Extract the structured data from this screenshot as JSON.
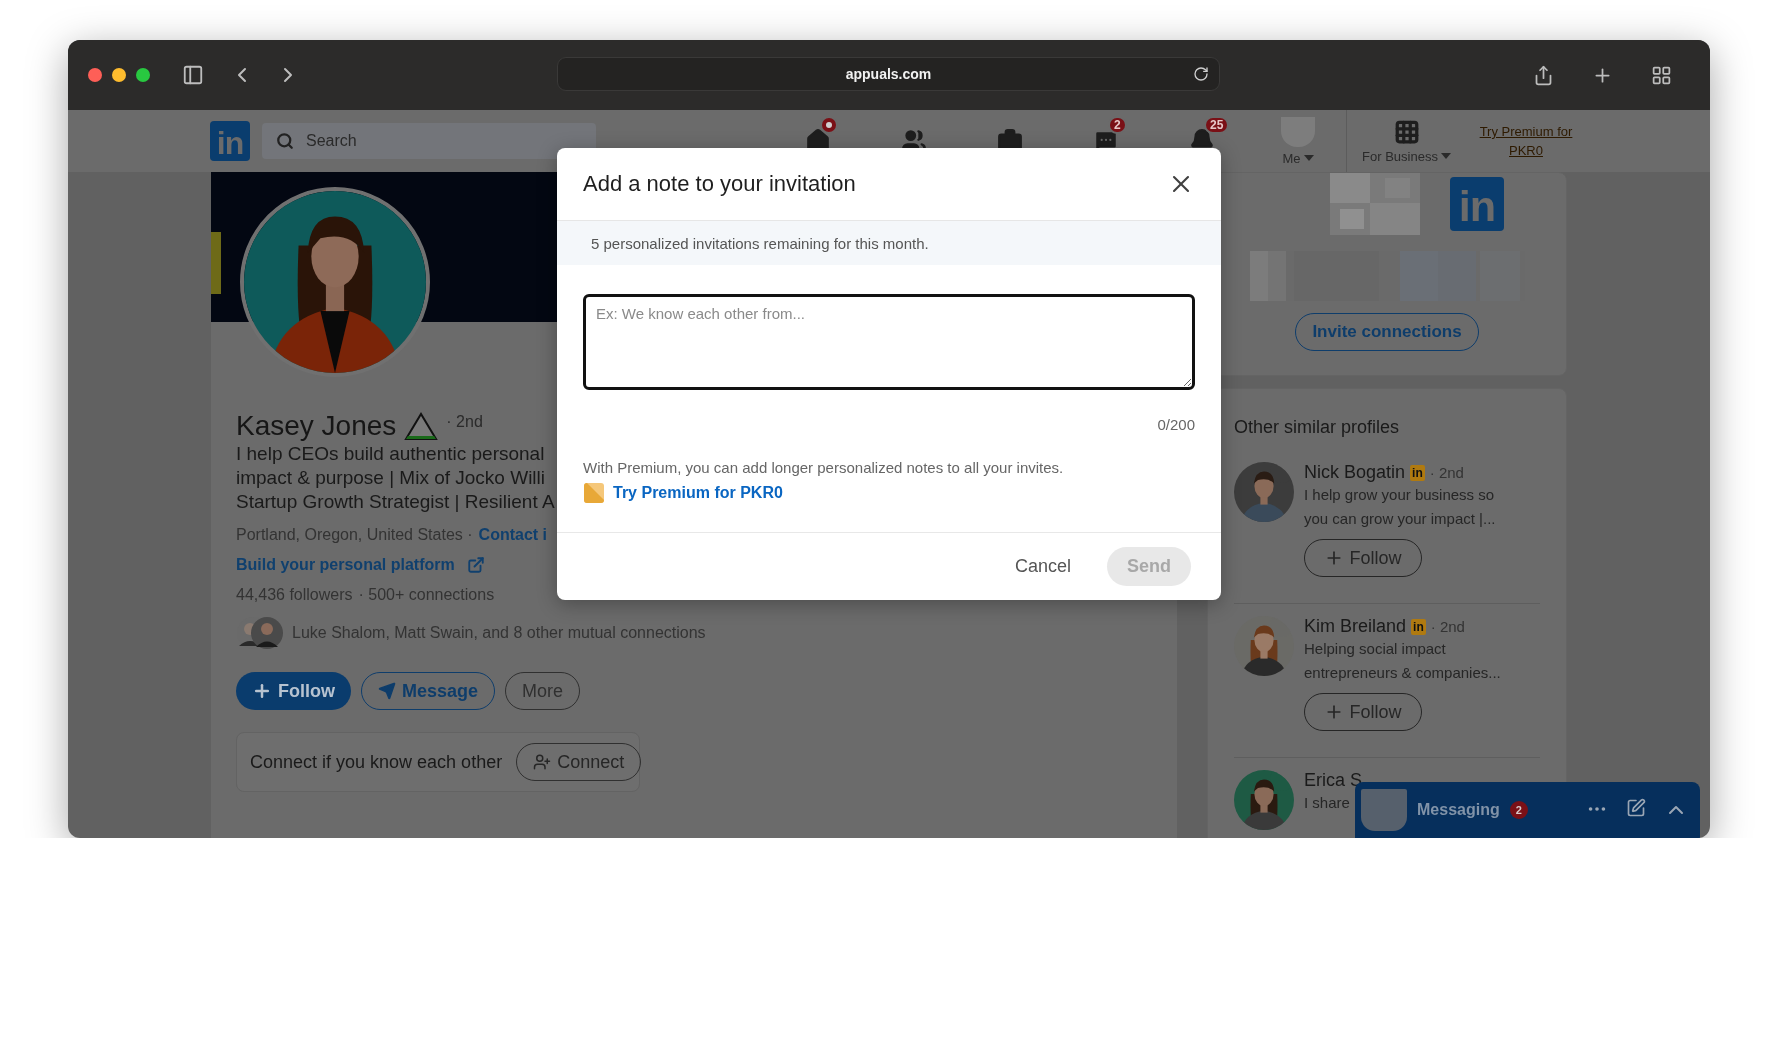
{
  "browser": {
    "url": "appuals.com"
  },
  "nav": {
    "logo": "in",
    "search_placeholder": "Search",
    "items": [
      {
        "kind": "home",
        "badge_dot": true
      },
      {
        "kind": "network"
      },
      {
        "kind": "jobs"
      },
      {
        "kind": "messaging",
        "badge": "2"
      },
      {
        "kind": "notifications",
        "badge": "25"
      }
    ],
    "me": {
      "label": "Me"
    },
    "business": {
      "label": "For Business"
    },
    "premium_link": "Try Premium for PKR0"
  },
  "profile": {
    "name": "Kasey Jones",
    "degree": "· 2nd",
    "headline_lines": [
      "I help CEOs build authentic personal",
      "impact & purpose | Mix of Jocko Willi",
      "Startup Growth Strategist | Resilient A"
    ],
    "location": "Portland, Oregon, United States ·",
    "contact": "Contact i",
    "website": "Build your personal platform",
    "followers": "44,436 followers",
    "connections": "· 500+ connections",
    "mutual": "Luke Shalom, Matt Swain, and 8 other mutual connections",
    "actions": [
      {
        "label": "Follow",
        "kind": "primary"
      },
      {
        "label": "Message",
        "kind": "message"
      },
      {
        "label": "More",
        "kind": "plain"
      }
    ],
    "connect_prompt": "Connect if you know each other",
    "connect_button": "Connect"
  },
  "sidebar": {
    "logo": "in",
    "invite_button": "Invite connections",
    "similar_title": "Other similar profiles",
    "people": [
      {
        "name": "Nick Bogatin",
        "badge": "in",
        "degree": "· 2nd",
        "headline_lines": [
          "I help grow your business so",
          "you can grow your impact |..."
        ],
        "follow": "Follow"
      },
      {
        "name": "Kim Breiland",
        "badge": "in",
        "degree": "· 2nd",
        "headline_lines": [
          "Helping social impact",
          "entrepreneurs & companies..."
        ],
        "follow": "Follow"
      },
      {
        "name": "Erica S",
        "headline_lines": [
          "I share"
        ]
      }
    ]
  },
  "messaging": {
    "title": "Messaging",
    "badge": "2"
  },
  "modal": {
    "title": "Add a note to your invitation",
    "notice": "5 personalized invitations remaining for this month.",
    "placeholder": "Ex: We know each other from...",
    "counter": "0/200",
    "premium_text": "With Premium, you can add longer personalized notes to all your invites.",
    "premium_link": "Try Premium for PKR0",
    "buttons": [
      {
        "label": "Cancel",
        "kind": "text",
        "disabled": false
      },
      {
        "label": "Send",
        "kind": "primary",
        "disabled": true
      }
    ]
  }
}
